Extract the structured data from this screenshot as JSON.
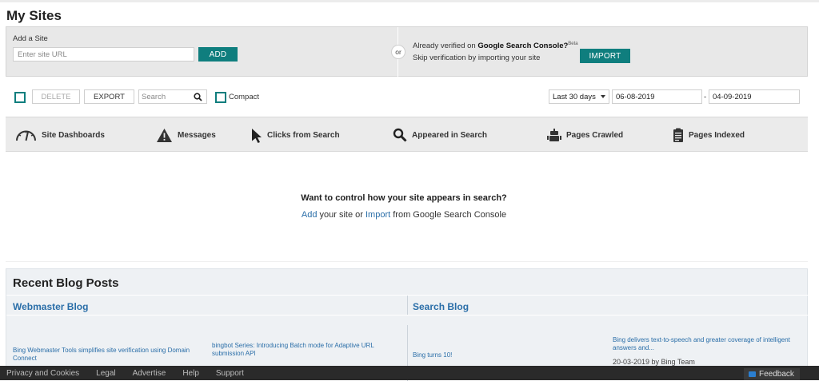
{
  "page": {
    "title": "My Sites"
  },
  "add_site": {
    "label": "Add a Site",
    "url_placeholder": "Enter site URL",
    "add_button": "ADD",
    "or_text": "or",
    "import_line1_prefix": "Already verified on ",
    "import_line1_bold": "Google Search Console?",
    "import_line1_sup": "Beta",
    "import_line2": "Skip verification by importing your site",
    "import_button": "IMPORT"
  },
  "toolbar": {
    "delete_label": "DELETE",
    "export_label": "EXPORT",
    "search_placeholder": "Search",
    "compact_label": "Compact",
    "date_range": "Last 30 days",
    "date_from": "06-08-2019",
    "date_separator": "-",
    "date_to": "04-09-2019"
  },
  "tabs": [
    {
      "label": "Site Dashboards",
      "icon": "gauge-icon"
    },
    {
      "label": "Messages",
      "icon": "warning-icon"
    },
    {
      "label": "Clicks from Search",
      "icon": "cursor-icon"
    },
    {
      "label": "Appeared in Search",
      "icon": "magnifier-icon"
    },
    {
      "label": "Pages Crawled",
      "icon": "robot-icon"
    },
    {
      "label": "Pages Indexed",
      "icon": "clipboard-icon"
    }
  ],
  "empty_state": {
    "heading": "Want to control how your site appears in search?",
    "add_link": "Add",
    "middle_text": " your site or ",
    "import_link": "Import",
    "tail_text": " from Google Search Console"
  },
  "blog": {
    "title": "Recent Blog Posts",
    "webmaster_title": "Webmaster Blog",
    "search_title": "Search Blog",
    "webmaster_posts": [
      {
        "title": "Bing Webmaster Tools simplifies site verification using Domain Connect"
      },
      {
        "title": "bingbot Series: Introducing Batch mode for Adaptive URL submission API"
      }
    ],
    "search_posts": [
      {
        "title": "Bing turns 10!"
      },
      {
        "title": "Bing delivers text-to-speech and greater coverage of intelligent answers and...",
        "date": "20-03-2019 by Bing Team"
      }
    ]
  },
  "footer": {
    "links": [
      "Privacy and Cookies",
      "Legal",
      "Advertise",
      "Help",
      "Support"
    ],
    "feedback": "Feedback"
  },
  "colors": {
    "accent": "#0f7e7e",
    "link": "#2a6ea8"
  }
}
